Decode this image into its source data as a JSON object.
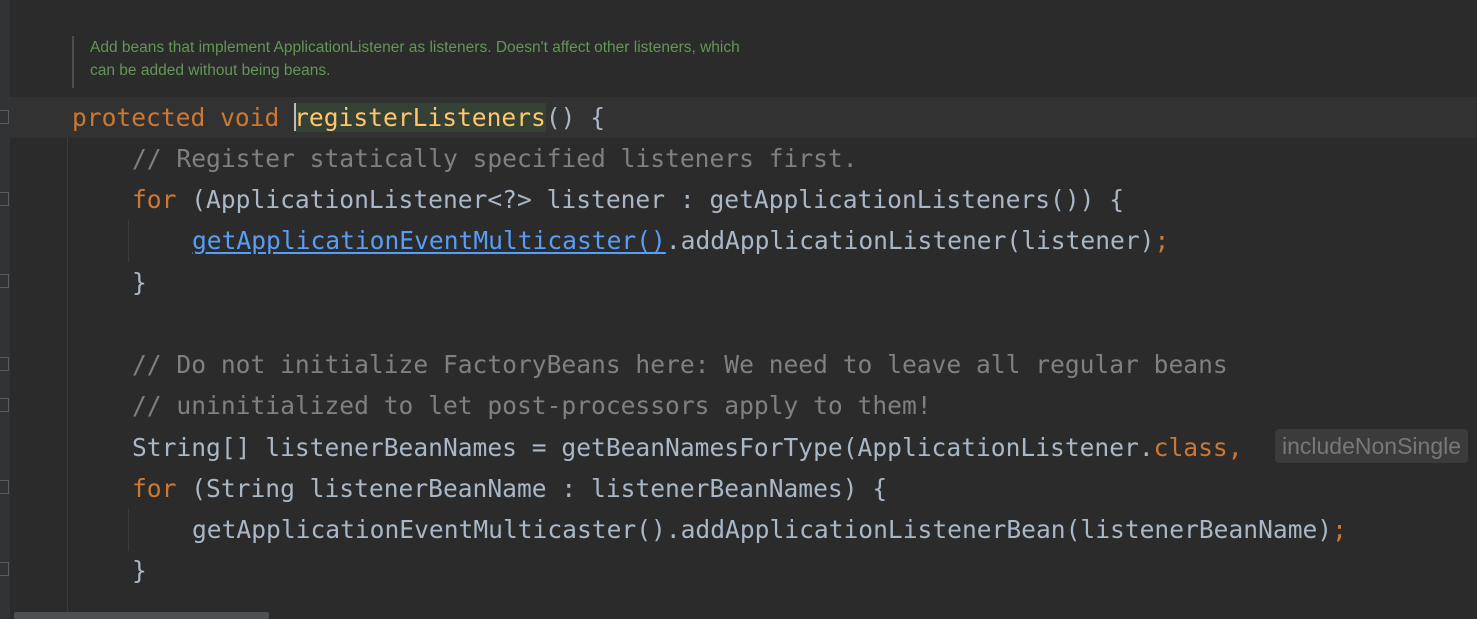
{
  "doc_comment": {
    "lines": [
      "Add beans that implement ApplicationListener as listeners. Doesn't affect other listeners, which",
      "can be added without being beans."
    ]
  },
  "code": {
    "line1": {
      "kw_protected": "protected",
      "kw_void": "void",
      "method_name": "registerListeners",
      "rest": "() {"
    },
    "line2": {
      "comment": "// Register statically specified listeners first."
    },
    "line3": {
      "kw_for": "for",
      "rest": " (ApplicationListener<?> listener : getApplicationListeners()) {"
    },
    "line4": {
      "link_call": "getApplicationEventMulticaster()",
      "rest": ".addApplicationListener(listener)",
      "semicolon": ";"
    },
    "line5": {
      "brace": "}"
    },
    "line6": {
      "comment": "// Do not initialize FactoryBeans here: We need to leave all regular beans"
    },
    "line7": {
      "comment": "// uninitialized to let post-processors apply to them!"
    },
    "line8": {
      "prefix": "String[] listenerBeanNames = getBeanNamesForType(ApplicationListener.",
      "kw_class": "class",
      "comma": ","
    },
    "line9": {
      "kw_for": "for",
      "rest": " (String listenerBeanName : listenerBeanNames) {"
    },
    "line10": {
      "call": "getApplicationEventMulticaster().addApplicationListenerBean(listenerBeanName)",
      "semicolon": ";"
    },
    "line11": {
      "brace": "}"
    }
  },
  "inlay_hint": {
    "text": "includeNonSingle"
  },
  "colors": {
    "background": "#2b2b2b",
    "keyword": "#cc7832",
    "comment": "#808080",
    "doc_comment": "#629755",
    "method_declaration": "#ffc66d",
    "link": "#589df6",
    "default_text": "#a9b7c6"
  }
}
